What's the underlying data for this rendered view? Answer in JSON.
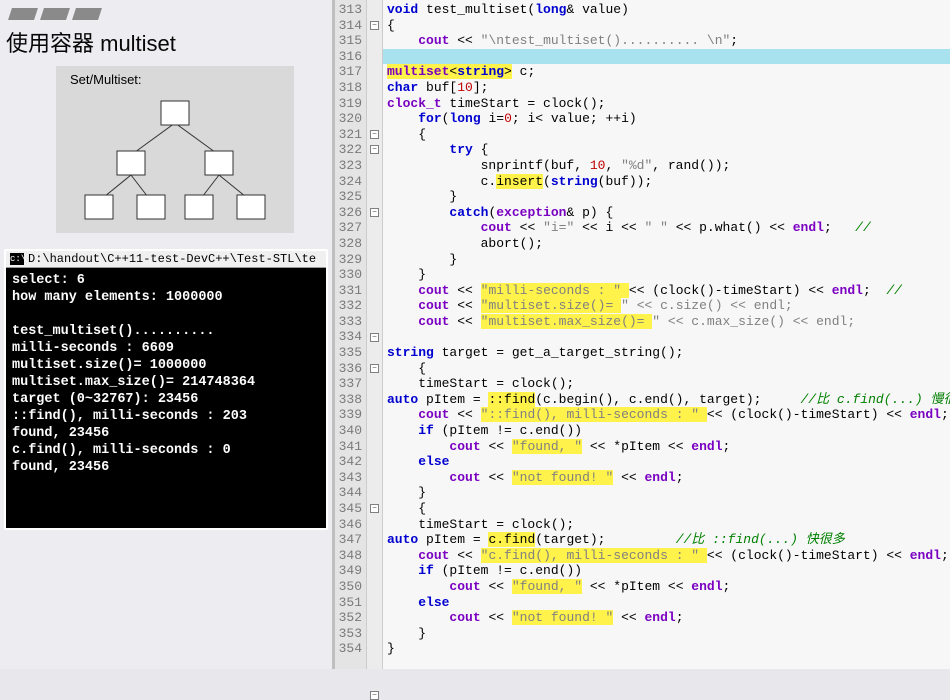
{
  "slide": {
    "title": "使用容器 multiset",
    "diagram_label": "Set/Multiset:"
  },
  "terminal": {
    "title": "D:\\handout\\C++11-test-DevC++\\Test-STL\\te",
    "lines": [
      "select: 6",
      "how many elements: 1000000",
      "",
      "test_multiset()..........",
      "milli-seconds : 6609",
      "multiset.size()= 1000000",
      "multiset.max_size()= 214748364",
      "target (0~32767): 23456",
      "::find(), milli-seconds : 203",
      "found, 23456",
      "c.find(), milli-seconds : 0",
      "found, 23456"
    ]
  },
  "editor": {
    "first_line": 313,
    "highlight_row": 3,
    "lines": [
      "void test_multiset(long& value)",
      "{",
      "    cout << \"\\ntest_multiset().......... \\n\";",
      "    ",
      "multiset<string> c;",
      "char buf[10];",
      "clock_t timeStart = clock();",
      "    for(long i=0; i< value; ++i)",
      "    {",
      "        try {",
      "            snprintf(buf, 10, \"%d\", rand());",
      "            c.insert(string(buf));",
      "        }",
      "        catch(exception& p) {",
      "            cout << \"i=\" << i << \" \" << p.what() << endl;   //",
      "            abort();",
      "        }",
      "    }",
      "    cout << \"milli-seconds : \" << (clock()-timeStart) << endl;  //",
      "    cout << \"multiset.size()= \" << c.size() << endl;",
      "    cout << \"multiset.max_size()= \" << c.max_size() << endl;",
      "",
      "string target = get_a_target_string();",
      "    {",
      "    timeStart = clock();",
      "auto pItem = ::find(c.begin(), c.end(), target);     //比 c.find(...) 慢很多",
      "    cout << \"::find(), milli-seconds : \" << (clock()-timeStart) << endl;",
      "    if (pItem != c.end())",
      "        cout << \"found, \" << *pItem << endl;",
      "    else",
      "        cout << \"not found! \" << endl;",
      "    }",
      "    {",
      "    timeStart = clock();",
      "auto pItem = c.find(target);         //比 ::find(...) 快很多",
      "    cout << \"c.find(), milli-seconds : \" << (clock()-timeStart) << endl;",
      "    if (pItem != c.end())",
      "        cout << \"found, \" << *pItem << endl;",
      "    else",
      "        cout << \"not found! \" << endl;",
      "    }",
      "}"
    ]
  },
  "highlights": {
    "5": [
      [
        0,
        16
      ]
    ],
    "12": [
      [
        14,
        20
      ]
    ],
    "19": [
      [
        12,
        31
      ]
    ],
    "20": [
      [
        12,
        30
      ]
    ],
    "21": [
      [
        12,
        34
      ]
    ],
    "26": [
      [
        13,
        19
      ]
    ],
    "27": [
      [
        12,
        41
      ]
    ],
    "29": [
      [
        16,
        25
      ]
    ],
    "31": [
      [
        16,
        29
      ]
    ],
    "35": [
      [
        13,
        19
      ]
    ],
    "36": [
      [
        12,
        41
      ]
    ],
    "38": [
      [
        16,
        25
      ]
    ],
    "40": [
      [
        16,
        29
      ]
    ]
  },
  "fold_marks": [
    2,
    9,
    10,
    14,
    22,
    24,
    33,
    45
  ]
}
